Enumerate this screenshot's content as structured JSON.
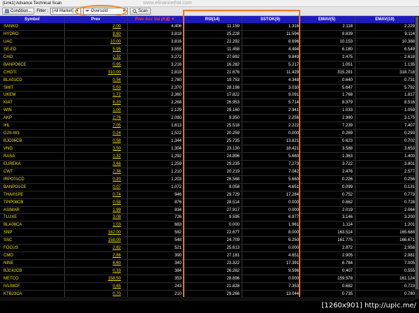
{
  "window": {
    "title": "[Link1] Advance Technical Scan",
    "watermark": "www.efinancethai.com"
  },
  "toolbar": {
    "condition_label": "Condition...",
    "filter_label": "Filter :",
    "market_value": "[All Market]",
    "scan_type_value": "Oversold",
    "scan_label": "Scan"
  },
  "columns": {
    "symbol": "Symbol",
    "prev": "Prev",
    "prev_acc_val": "Prev Acc Val (K฿)",
    "rsi": "RSI(14)",
    "sstok": "SSTOK(9)",
    "emav5": "EMAV(5)",
    "emav10": "EMAV(10)"
  },
  "rows": [
    {
      "symbol": "SANKO",
      "prev": "2.00",
      "acc": "4,406",
      "rsi": "11.159",
      "sto": "1.316",
      "e5": "2.118",
      "e10": "2.229"
    },
    {
      "symbol": "HYDRO",
      "prev": "8.60",
      "acc": "3,818",
      "rsi": "25.228",
      "sto": "11.594",
      "e5": "8.839",
      "e10": "9.114"
    },
    {
      "symbol": "UAC",
      "prev": "10.00",
      "acc": "3,816",
      "rsi": "22.292",
      "sto": "8.696",
      "e5": "10.153",
      "e10": "10.388"
    },
    {
      "symbol": "SE-ED",
      "prev": "5.95",
      "acc": "3,555",
      "rsi": "11.458",
      "sto": "4.494",
      "e5": "6.180",
      "e10": "6.549"
    },
    {
      "symbol": "CHO",
      "prev": "2.32",
      "acc": "3,272",
      "rsi": "27.692",
      "sto": "9.849",
      "e5": "2.475",
      "e10": "2.618"
    },
    {
      "symbol": "BANPO6CE",
      "prev": "0.95",
      "acc": "3,216",
      "rsi": "16.282",
      "sto": "5.217",
      "e5": "1.051",
      "e10": "1.135"
    },
    {
      "symbol": "CHOTI",
      "prev": "310.00",
      "acc": "2,819",
      "rsi": "21.676",
      "sto": "11.429",
      "e5": "315.291",
      "e10": "318.718"
    },
    {
      "symbol": "BLA01CD",
      "prev": "0.54",
      "acc": "2,780",
      "rsi": "19.753",
      "sto": "4.348",
      "e5": "0.640",
      "e10": "0.731"
    },
    {
      "symbol": "SMIT",
      "prev": "5.50",
      "acc": "2,370",
      "rsi": "28.198",
      "sto": "3.030",
      "e5": "5.647",
      "e10": "5.792"
    },
    {
      "symbol": "UKEM",
      "prev": "1.72",
      "acc": "2,360",
      "rsi": "17.822",
      "sto": "9.091",
      "e5": "1.768",
      "e10": "1.817"
    },
    {
      "symbol": "KIAT",
      "prev": "8.20",
      "acc": "2,268",
      "rsi": "26.953",
      "sto": "5.714",
      "e5": "8.379",
      "e10": "8.516"
    },
    {
      "symbol": "WIN",
      "prev": "1.00",
      "acc": "2,129",
      "rsi": "29.160",
      "sto": "2.941",
      "e5": "1.033",
      "e10": "1.059"
    },
    {
      "symbol": "AKP",
      "prev": "2.76",
      "acc": "2,080",
      "rsi": "9.350",
      "sto": "2.256",
      "e5": "2.980",
      "e10": "3.175"
    },
    {
      "symbol": "IHL",
      "prev": "7.05",
      "acc": "1,613",
      "rsi": "25.518",
      "sto": "2.222",
      "e5": "7.239",
      "e10": "7.407"
    },
    {
      "symbol": "GJS-W3",
      "prev": "0.24",
      "acc": "1,522",
      "rsi": "20.259",
      "sto": "0.000",
      "e5": "0.269",
      "e10": "0.293"
    },
    {
      "symbol": "BJC06CB",
      "prev": "0.58",
      "acc": "1,344",
      "rsi": "25.735",
      "sto": "13.821",
      "e5": "0.623",
      "e10": "0.702"
    },
    {
      "symbol": "VNG",
      "prev": "3.50",
      "acc": "1,304",
      "rsi": "23.130",
      "sto": "18.421",
      "e5": "3.588",
      "e10": "3.653"
    },
    {
      "symbol": "RASA",
      "prev": "1.32",
      "acc": "1,292",
      "rsi": "24.896",
      "sto": "5.660",
      "e5": "1.363",
      "e10": "1.400"
    },
    {
      "symbol": "EUREKA",
      "prev": "3.66",
      "acc": "1,259",
      "rsi": "29.235",
      "sto": "7.273",
      "e5": "3.722",
      "e10": "3.801"
    },
    {
      "symbol": "CWT",
      "prev": "2.38",
      "acc": "1,210",
      "rsi": "20.219",
      "sto": "7.042",
      "e5": "2.476",
      "e10": "2.577"
    },
    {
      "symbol": "IRPC01CD",
      "prev": "0.20",
      "acc": "1,203",
      "rsi": "26.568",
      "sto": "5.660",
      "e5": "0.226",
      "e10": "0.256"
    },
    {
      "symbol": "BANPO1CE",
      "prev": "0.07",
      "acc": "1,072",
      "rsi": "8.058",
      "sto": "4.651",
      "e5": "0.099",
      "e10": "0.131"
    },
    {
      "symbol": "THAI01PE",
      "prev": "0.74",
      "acc": "946",
      "rsi": "29.729",
      "sto": "17.284",
      "e5": "0.752",
      "e10": "0.773"
    },
    {
      "symbol": "TPIP08CB",
      "prev": "0.58",
      "acc": "876",
      "rsi": "28.514",
      "sto": "0.000",
      "e5": "0.662",
      "e10": "0.728"
    },
    {
      "symbol": "ASIMAR",
      "prev": "1.99",
      "acc": "834",
      "rsi": "27.917",
      "sto": "0.000",
      "e5": "2.019",
      "e10": "2.064"
    },
    {
      "symbol": "TLUXE",
      "prev": "3.08",
      "acc": "726",
      "rsi": "9.595",
      "sto": "6.977",
      "e5": "3.146",
      "e10": "3.200"
    },
    {
      "symbol": "BLA06CA",
      "prev": "1.03",
      "acc": "663",
      "rsi": "0.000",
      "sto": "1.961",
      "e5": "1.114",
      "e10": "1.201"
    },
    {
      "symbol": "SNP",
      "prev": "162.00",
      "acc": "582",
      "rsi": "22.677",
      "sto": "8.000",
      "e5": "163.514",
      "e10": "165.688"
    },
    {
      "symbol": "SSC",
      "prev": "158.00",
      "acc": "548",
      "rsi": "24.709",
      "sto": "6.250",
      "e5": "161.775",
      "e10": "166.671"
    },
    {
      "symbol": "FOCUS",
      "prev": "2.82",
      "acc": "521",
      "rsi": "25.613",
      "sto": "0.000",
      "e5": "2.872",
      "e10": "2.958"
    },
    {
      "symbol": "CMO",
      "prev": "2.86",
      "acc": "390",
      "rsi": "27.181",
      "sto": "4.651",
      "e5": "2.905",
      "e10": "2.981"
    },
    {
      "symbol": "NINE",
      "prev": "6.60",
      "acc": "340",
      "rsi": "23.322",
      "sto": "17.391",
      "e5": "6.784",
      "e10": "7.005"
    },
    {
      "symbol": "BJC42CB",
      "prev": "0.33",
      "acc": "384",
      "rsi": "26.262",
      "sto": "9.596",
      "e5": "0.407",
      "e10": "0.555"
    },
    {
      "symbol": "METCO",
      "prev": "158.50",
      "acc": "353",
      "rsi": "28.696",
      "sto": "0.000",
      "e5": "159.578",
      "e10": "161.124"
    },
    {
      "symbol": "IVL08CF",
      "prev": "0.65",
      "acc": "243",
      "rsi": "21.828",
      "sto": "7.353",
      "e5": "0.682",
      "e10": "0.723"
    },
    {
      "symbol": "KTB23CA",
      "prev": "0.70",
      "acc": "210",
      "rsi": "29.266",
      "sto": "13.044",
      "e5": "0.735",
      "e10": "0.780"
    }
  ],
  "footer": {
    "dimension_text": "[1260x901] http://upic.me/"
  },
  "colors": {
    "header_bg": "#1f1bb8",
    "symbol_text": "#f5e400",
    "highlight_outline": "#e8772a"
  },
  "icons": {
    "condition": "condition-icon",
    "filter_type": "filter-icon",
    "scan": "scan-icon"
  }
}
